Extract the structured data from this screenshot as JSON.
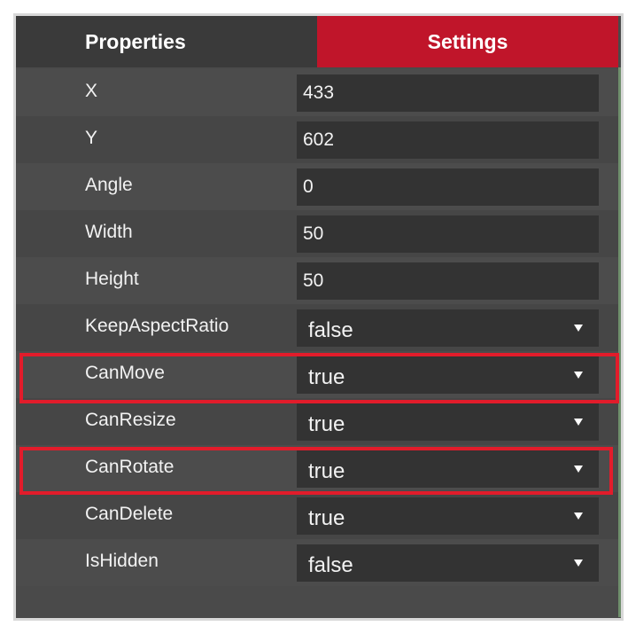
{
  "tabs": {
    "properties_label": "Properties",
    "settings_label": "Settings"
  },
  "rows": [
    {
      "label": "X",
      "value": "433",
      "kind": "text"
    },
    {
      "label": "Y",
      "value": "602",
      "kind": "text"
    },
    {
      "label": "Angle",
      "value": "0",
      "kind": "text"
    },
    {
      "label": "Width",
      "value": "50",
      "kind": "text"
    },
    {
      "label": "Height",
      "value": "50",
      "kind": "text"
    },
    {
      "label": "KeepAspectRatio",
      "value": "false",
      "kind": "select"
    },
    {
      "label": "CanMove",
      "value": "true",
      "kind": "select"
    },
    {
      "label": "CanResize",
      "value": "true",
      "kind": "select"
    },
    {
      "label": "CanRotate",
      "value": "true",
      "kind": "select"
    },
    {
      "label": "CanDelete",
      "value": "true",
      "kind": "select"
    },
    {
      "label": "IsHidden",
      "value": "false",
      "kind": "select"
    }
  ],
  "colors": {
    "accent": "#c0152a",
    "highlight": "#e21c2b",
    "panel": "#4a4a4a",
    "field": "#333333"
  }
}
